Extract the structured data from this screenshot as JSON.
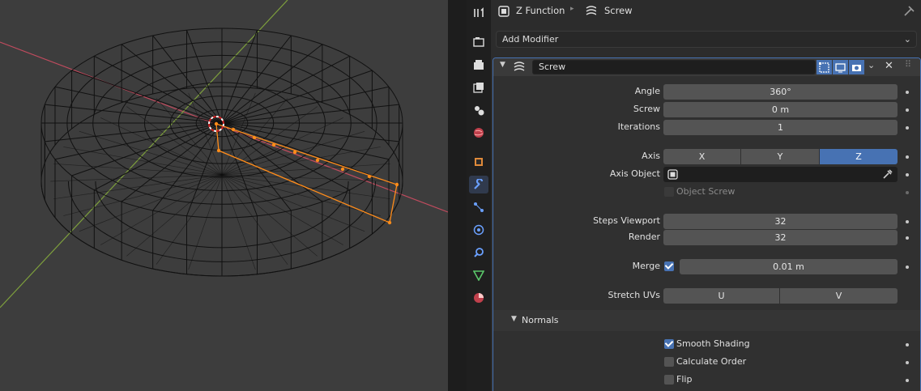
{
  "breadcrumb": {
    "object": "Z Function",
    "modifier": "Screw"
  },
  "add_modifier": {
    "label": "Add Modifier"
  },
  "modifier": {
    "name": "Screw",
    "angle_label": "Angle",
    "angle": "360°",
    "screw_label": "Screw",
    "screw": "0 m",
    "iterations_label": "Iterations",
    "iterations": "1",
    "axis_label": "Axis",
    "axis_options": [
      "X",
      "Y",
      "Z"
    ],
    "axis_selected": "Z",
    "axis_object_label": "Axis Object",
    "object_screw_label": "Object Screw",
    "steps_viewport_label": "Steps Viewport",
    "steps_viewport": "32",
    "render_label": "Render",
    "render": "32",
    "merge_label": "Merge",
    "merge": "0.01 m",
    "merge_checked": true,
    "stretch_uvs_label": "Stretch UVs",
    "stretch_u": "U",
    "stretch_v": "V"
  },
  "normals": {
    "title": "Normals",
    "smooth_shading_label": "Smooth Shading",
    "smooth_shading": true,
    "calculate_order_label": "Calculate Order",
    "calculate_order": false,
    "flip_label": "Flip",
    "flip": false
  },
  "tabs": [
    "tool-icon",
    "render-icon",
    "output-icon",
    "view-layer-icon",
    "scene-icon",
    "world-icon",
    "object-icon",
    "modifier-icon",
    "particles-icon",
    "physics-icon",
    "constraints-icon",
    "data-icon",
    "material-icon"
  ],
  "colors": {
    "accent": "#4772b3",
    "selection": "#ff8c1a",
    "x_axis": "#c04b5e",
    "y_axis": "#7ea03d"
  }
}
